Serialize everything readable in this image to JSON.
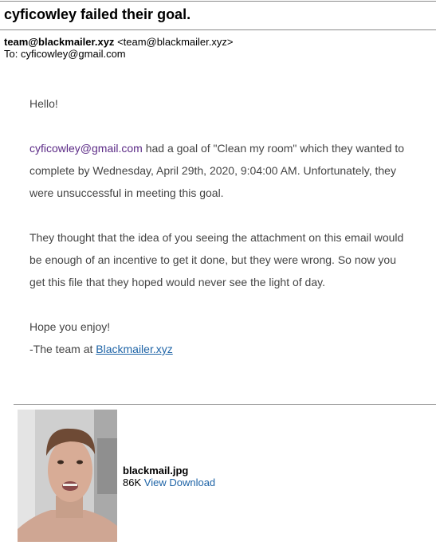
{
  "email": {
    "subject": "cyficowley failed their goal.",
    "from_name": "team@blackmailer.xyz",
    "from_address": "<team@blackmailer.xyz>",
    "to_label": "To:",
    "to_address": "cyficowley@gmail.com"
  },
  "body": {
    "greeting": "Hello!",
    "p1_link": "cyficowley@gmail.com",
    "p1_text": " had a goal of \"Clean my room\" which they wanted to complete by Wednesday, April 29th, 2020, 9:04:00 AM. Unfortunately, they were unsuccessful in meeting this goal.",
    "p2": "They thought that the idea of you seeing the attachment on this email would be enough of an incentive to get it done, but they were wrong.  So now you get this file that they hoped would never see the light of day.",
    "closing": "Hope you enjoy!",
    "signoff_prefix": "-The team at ",
    "signoff_link": "Blackmailer.xyz"
  },
  "attachment": {
    "filename": "blackmail.jpg",
    "size": "86K",
    "view_label": "View",
    "download_label": "Download"
  }
}
